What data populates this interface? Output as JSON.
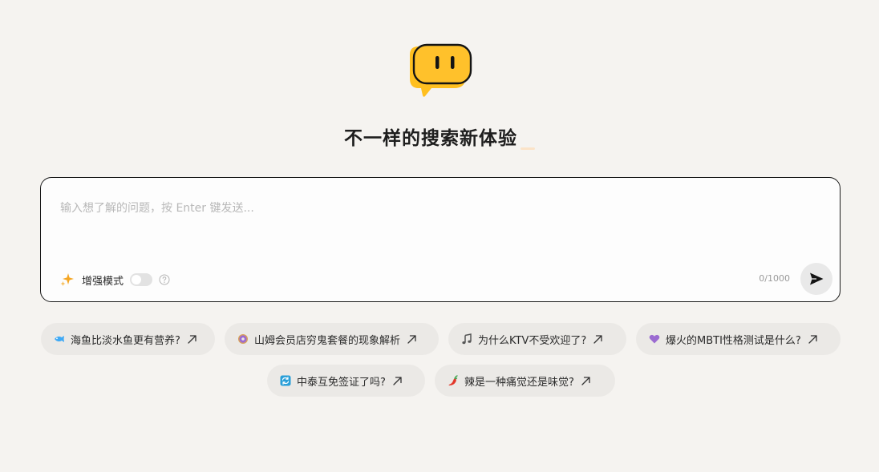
{
  "header": {
    "title": "不一样的搜索新体验"
  },
  "search": {
    "placeholder": "输入想了解的问题，按 Enter 键发送...",
    "value": "",
    "enhance_label": "增强模式",
    "enhance_enabled": false,
    "char_counter": "0/1000"
  },
  "suggestions": [
    {
      "icon": "fish-icon",
      "label": "海鱼比淡水鱼更有营养?"
    },
    {
      "icon": "donut-icon",
      "label": "山姆会员店穷鬼套餐的现象解析"
    },
    {
      "icon": "music-note-icon",
      "label": "为什么KTV不受欢迎了?"
    },
    {
      "icon": "purple-heart-icon",
      "label": "爆火的MBTI性格测试是什么?"
    },
    {
      "icon": "exchange-icon",
      "label": "中泰互免签证了吗?"
    },
    {
      "icon": "chili-pepper-icon",
      "label": "辣是一种痛觉还是味觉?"
    }
  ],
  "colors": {
    "background": "#f5f3f0",
    "logo_yellow": "#ffbf1f",
    "chip_background": "#ebe9e6",
    "border": "#1a1a1a"
  }
}
